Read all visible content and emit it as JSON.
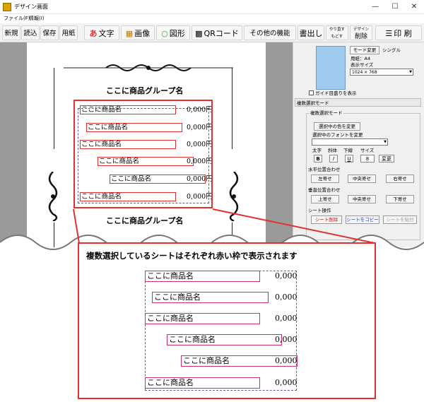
{
  "window": {
    "title": "デザイン画面",
    "minimize": "—",
    "maximize": "☐",
    "close": "✕"
  },
  "menu": {
    "file": "ファイル(F)",
    "info": "情報(I)"
  },
  "toolbar": {
    "new": "新規",
    "load": "読込",
    "save": "保存",
    "paper": "用紙",
    "text_icon": "あ",
    "text": "文字",
    "image": "画像",
    "shape": "図形",
    "qr": "QRコード",
    "other": "その他の機能",
    "export": "書出し",
    "redo": "やり直す",
    "undo": "もどす",
    "design": "デザイン",
    "delete": "削除",
    "print": "印 刷"
  },
  "canvas": {
    "group_title_top": "ここに商品グループ名",
    "group_title_bottom": "ここに商品グループ名",
    "items": [
      {
        "name": "ここに商品名",
        "price": "0,000円"
      },
      {
        "name": "ここに商品名",
        "price": "0,000円"
      },
      {
        "name": "ここに商品名",
        "price": "0,000円"
      },
      {
        "name": "ここに商品名",
        "price": "0,000円"
      },
      {
        "name": "ここに商品名",
        "price": "0,000円"
      },
      {
        "name": "ここに商品名",
        "price": "0,000円"
      }
    ]
  },
  "panel": {
    "mode_change": "モード変更",
    "single": "シングル",
    "paper_label": "用紙：A4",
    "display_size_label": "表示サイズ",
    "display_size_value": "1024 × 768",
    "guide_lines": "ガイド目盛りを表示",
    "mode_title": "複数選択モード",
    "group_multi": "複数選択モード",
    "change_color": "選択中の色を変更",
    "font_label": "選択中のフォントを変更",
    "font_value": "",
    "bold_label": "太字",
    "italic_label": "斜体",
    "underline_label": "下線",
    "size_label": "サイズ",
    "bold_btn": "B",
    "italic_btn": "I",
    "underline_btn": "U",
    "size_value": "8",
    "size_change": "変更",
    "h_align_title": "水平位置合わせ",
    "left": "左寄せ",
    "h_center": "中央寄せ",
    "right": "右寄せ",
    "v_align_title": "垂直位置合わせ",
    "top": "上寄せ",
    "v_center": "中央寄せ",
    "bottom": "下寄せ",
    "sheet_ops_title": "シート操作",
    "sheet_delete": "シート削除",
    "sheet_copy": "シートをコピー",
    "sheet_paste": "シートを貼付"
  },
  "callout": {
    "text": "複数選択しているシートはそれぞれ赤い枠で表示されます",
    "items": [
      {
        "name": "ここに商品名",
        "price": "0,000"
      },
      {
        "name": "ここに商品名",
        "price": "0,000"
      },
      {
        "name": "ここに商品名",
        "price": "0,000"
      },
      {
        "name": "ここに商品名",
        "price": "0,000"
      },
      {
        "name": "ここに商品名",
        "price": "0,000"
      },
      {
        "name": "ここに商品名",
        "price": "0,000"
      }
    ]
  },
  "colors": {
    "selection_red": "#e03030",
    "preview_blue": "#9fc9ee",
    "sheet_delete_red": "#d01010",
    "sheet_copy_blue": "#1a3fc0"
  }
}
